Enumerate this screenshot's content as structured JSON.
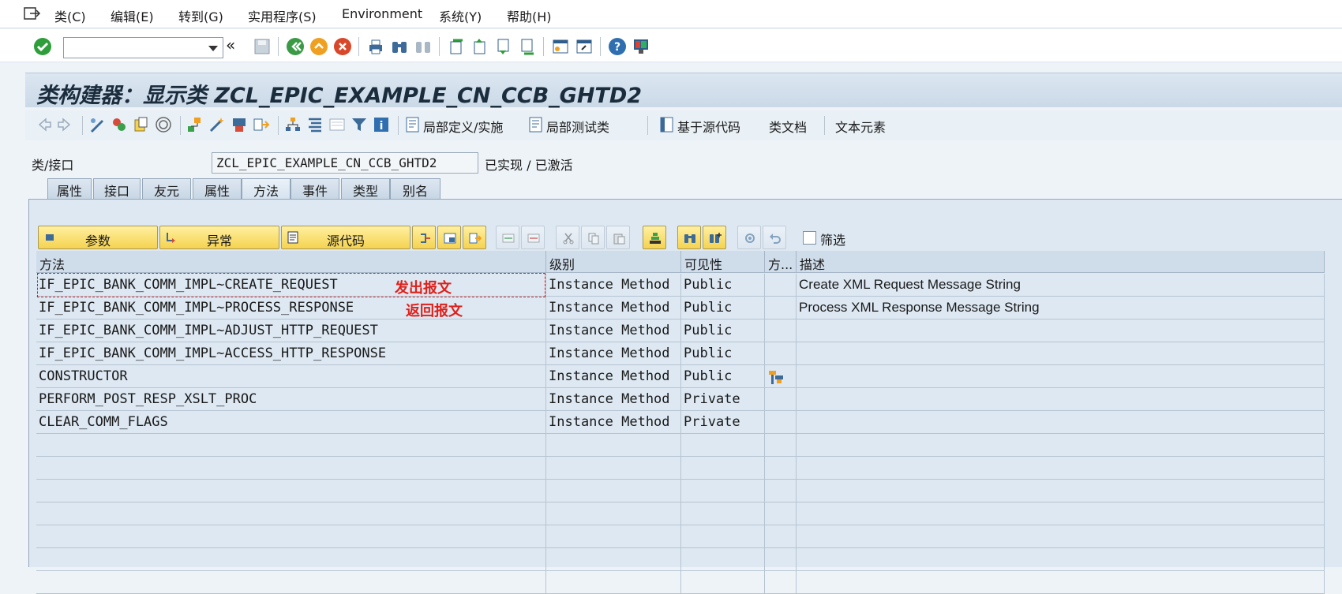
{
  "menu": {
    "items": [
      {
        "label": "类(C)"
      },
      {
        "label": "编辑(E)"
      },
      {
        "label": "转到(G)"
      },
      {
        "label": "实用程序(S)"
      },
      {
        "label": "Environment"
      },
      {
        "label": "系统(Y)"
      },
      {
        "label": "帮助(H)"
      }
    ]
  },
  "title": "类构建器：显示类 ZCL_EPIC_EXAMPLE_CN_CCB_GHTD2",
  "appbar": {
    "local_def": "局部定义/实施",
    "local_test": "局部测试类",
    "source_based": "基于源代码",
    "class_doc": "类文档",
    "text_elements": "文本元素"
  },
  "class_field": {
    "label": "类/接口",
    "value": "ZCL_EPIC_EXAMPLE_CN_CCB_GHTD2",
    "status": "已实现 / 已激活"
  },
  "tabs": [
    {
      "label": "属性"
    },
    {
      "label": "接口"
    },
    {
      "label": "友元"
    },
    {
      "label": "属性"
    },
    {
      "label": "方法"
    },
    {
      "label": "事件"
    },
    {
      "label": "类型"
    },
    {
      "label": "别名"
    }
  ],
  "method_toolbar": {
    "params": "参数",
    "exceptions": "异常",
    "source_code": "源代码",
    "filter": "筛选"
  },
  "table": {
    "headers": {
      "method": "方法",
      "level": "级别",
      "visibility": "可见性",
      "method_type": "方...",
      "description": "描述"
    },
    "rows": [
      {
        "method": "IF_EPIC_BANK_COMM_IMPL~CREATE_REQUEST",
        "level": "Instance Method",
        "visibility": "Public",
        "description": "Create XML Request Message String"
      },
      {
        "method": "IF_EPIC_BANK_COMM_IMPL~PROCESS_RESPONSE",
        "level": "Instance Method",
        "visibility": "Public",
        "description": "Process XML Response Message String"
      },
      {
        "method": "IF_EPIC_BANK_COMM_IMPL~ADJUST_HTTP_REQUEST",
        "level": "Instance Method",
        "visibility": "Public",
        "description": ""
      },
      {
        "method": "IF_EPIC_BANK_COMM_IMPL~ACCESS_HTTP_RESPONSE",
        "level": "Instance Method",
        "visibility": "Public",
        "description": ""
      },
      {
        "method": "CONSTRUCTOR",
        "level": "Instance Method",
        "visibility": "Public",
        "description": ""
      },
      {
        "method": "PERFORM_POST_RESP_XSLT_PROC",
        "level": "Instance Method",
        "visibility": "Private",
        "description": ""
      },
      {
        "method": "CLEAR_COMM_FLAGS",
        "level": "Instance Method",
        "visibility": "Private",
        "description": ""
      }
    ]
  },
  "annotations": {
    "send": "发出报文",
    "receive": "返回报文"
  },
  "colors": {
    "accent_red": "#e0201a",
    "button_yellow": "#f5d250",
    "grid_bg": "#dde8f2"
  }
}
